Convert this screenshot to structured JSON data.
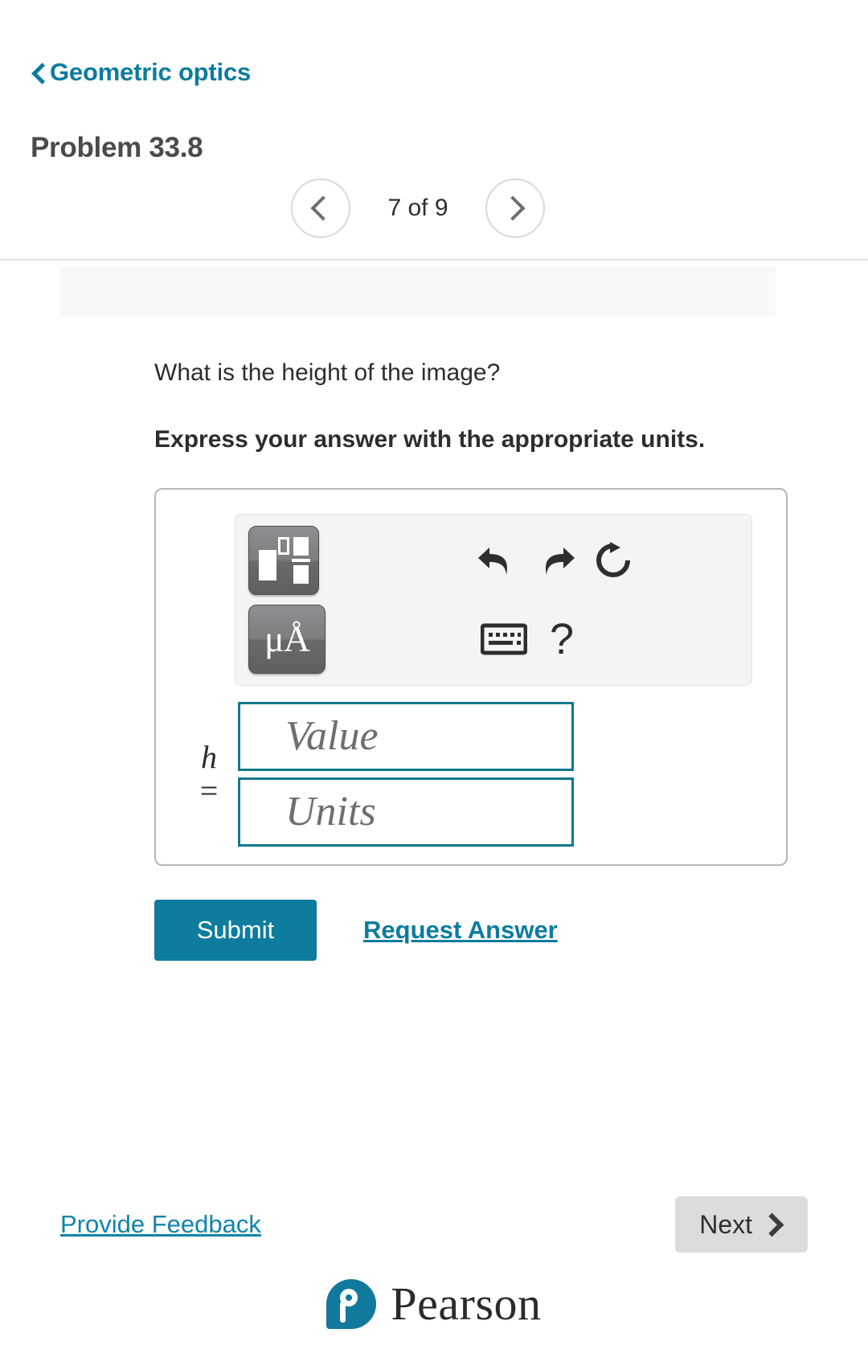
{
  "header": {
    "back_label": "Geometric optics",
    "back_icon": "chevron-left-icon",
    "problem_title": "Problem 33.8"
  },
  "pager": {
    "prev_icon": "chevron-left-icon",
    "next_icon": "chevron-right-icon",
    "count_label": "7 of 9",
    "current": 7,
    "total": 9
  },
  "question": {
    "prompt": "What is the height of the image?",
    "instruction": "Express your answer with the appropriate units."
  },
  "toolbar": {
    "template_button_icon": "math-template-icon",
    "units_button_label": "μÅ",
    "undo_icon": "undo-arrow-icon",
    "redo_icon": "redo-arrow-icon",
    "reset_icon": "reset-circular-arrow-icon",
    "keyboard_icon": "keyboard-icon",
    "help_label": "?"
  },
  "answer": {
    "variable": "h",
    "equals": "=",
    "value_placeholder": "Value",
    "units_placeholder": "Units",
    "value": "",
    "units": ""
  },
  "actions": {
    "submit_label": "Submit",
    "request_answer_label": "Request Answer"
  },
  "footer": {
    "feedback_label": "Provide Feedback",
    "next_label": "Next",
    "next_icon": "chevron-right-icon"
  },
  "brand": {
    "name": "Pearson",
    "logo_icon": "pearson-p-logo-icon"
  },
  "colors": {
    "accent_teal": "#0d7c9e",
    "field_border": "#12788f",
    "link_teal": "#1184ac",
    "next_button_bg": "#dcdcdc",
    "title_gray": "#4a4a4a"
  }
}
